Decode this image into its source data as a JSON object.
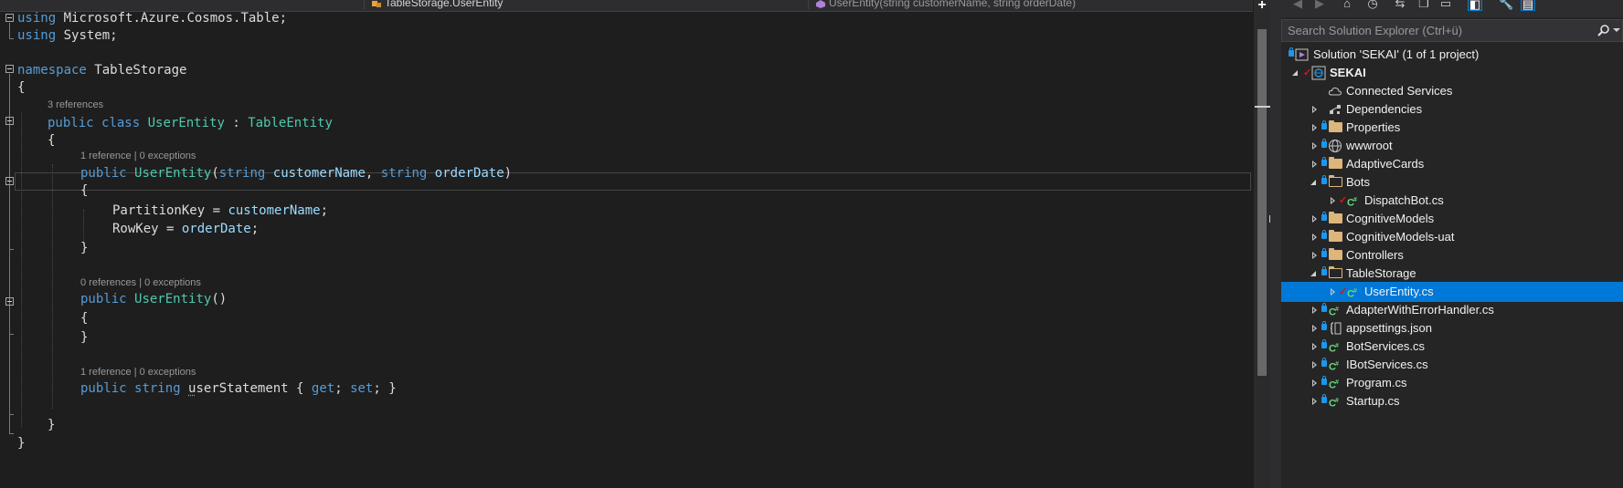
{
  "navbar": {
    "class_path": "TableStorage.UserEntity",
    "member": "UserEntity(string customerName, string orderDate)"
  },
  "code": {
    "l1": {
      "kw": "using",
      "rest": " Microsoft.Azure.Cosmos.Table;"
    },
    "l2": {
      "kw": "using",
      "rest": " System;"
    },
    "l4": {
      "kw": "namespace",
      "rest": " TableStorage"
    },
    "l5": "{",
    "lens1": "3 references",
    "l6": {
      "kw1": "public",
      "kw2": "class",
      "name": "UserEntity",
      "sep": " : ",
      "base": "TableEntity"
    },
    "l7": "{",
    "lens2": "1 reference | 0 exceptions",
    "l8": {
      "kw1": "public",
      "name": "UserEntity",
      "p1": "(",
      "t1": "string",
      "a1": "customerName",
      "p2": ", ",
      "t2": "string",
      "a2": "orderDate",
      "p3": ")"
    },
    "l9": "{",
    "l10": {
      "lhs": "PartitionKey = ",
      "rhs": "customerName",
      "end": ";"
    },
    "l11": {
      "lhs": "RowKey = ",
      "rhs": "orderDate",
      "end": ";"
    },
    "l12": "}",
    "lens3": "0 references | 0 exceptions",
    "l14": {
      "kw1": "public",
      "name": "UserEntity",
      "rest": "()"
    },
    "l15": "{",
    "l16": "}",
    "lens4": "1 reference | 0 exceptions",
    "l18": {
      "kw1": "public",
      "kw2": "string",
      "prop_prefix": "u",
      "prop_rest": "serStatement",
      "b1": " { ",
      "get": "get",
      "mid": "; ",
      "set": "set",
      "b2": "; }"
    },
    "l20": "}",
    "l21": "}"
  },
  "solution_explorer": {
    "search_placeholder": "Search Solution Explorer (Ctrl+ü)",
    "toolbar": [
      "back",
      "forward",
      "home",
      "history",
      "sync",
      "pending-changes",
      "show-all",
      "sync-active",
      "properties",
      "preview"
    ],
    "solution_label": "Solution 'SEKAI' (1 of 1 project)",
    "project": "SEKAI",
    "items": [
      {
        "label": "Connected Services",
        "icon": "cloud-icon"
      },
      {
        "label": "Dependencies",
        "icon": "dependencies-icon"
      },
      {
        "label": "Properties",
        "icon": "properties-folder-icon"
      },
      {
        "label": "wwwroot",
        "icon": "globe-icon"
      },
      {
        "label": "AdaptiveCards",
        "icon": "folder-icon"
      },
      {
        "label": "Bots",
        "icon": "open-folder-icon"
      },
      {
        "label": "DispatchBot.cs",
        "icon": "csharp-file-icon"
      },
      {
        "label": "CognitiveModels",
        "icon": "folder-icon"
      },
      {
        "label": "CognitiveModels-uat",
        "icon": "folder-icon"
      },
      {
        "label": "Controllers",
        "icon": "folder-icon"
      },
      {
        "label": "TableStorage",
        "icon": "open-folder-icon"
      },
      {
        "label": "UserEntity.cs",
        "icon": "csharp-file-icon",
        "selected": true
      },
      {
        "label": "AdapterWithErrorHandler.cs",
        "icon": "csharp-file-icon"
      },
      {
        "label": "appsettings.json",
        "icon": "json-file-icon"
      },
      {
        "label": "BotServices.cs",
        "icon": "csharp-file-icon"
      },
      {
        "label": "IBotServices.cs",
        "icon": "csharp-file-icon"
      },
      {
        "label": "Program.cs",
        "icon": "csharp-file-icon"
      },
      {
        "label": "Startup.cs",
        "icon": "csharp-file-icon"
      }
    ]
  },
  "colors": {
    "keyword": "#569cd6",
    "type": "#4ec9b0",
    "parameter": "#9cdcfe",
    "text": "#dcdcdc",
    "selection": "#0078d7"
  }
}
